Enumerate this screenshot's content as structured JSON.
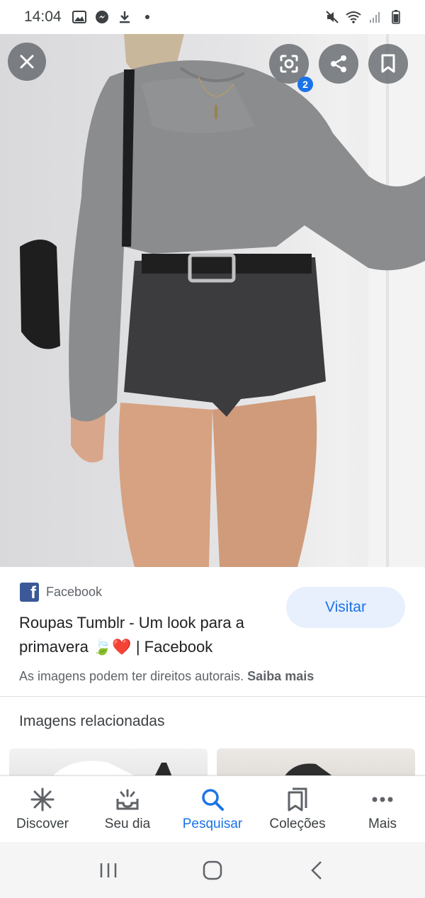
{
  "status_bar": {
    "time": "14:04",
    "left_icons": [
      "image-icon",
      "messenger-icon",
      "download-icon",
      "dot-icon"
    ],
    "right_icons": [
      "mute-icon",
      "wifi-icon",
      "signal-icon",
      "battery-icon"
    ]
  },
  "viewer": {
    "close_icon": "close-icon",
    "lens_icon": "lens-icon",
    "lens_badge": "2",
    "share_icon": "share-icon",
    "bookmark_icon": "bookmark-icon"
  },
  "source": {
    "site_name": "Facebook",
    "site_logo_letter": "f",
    "title": "Roupas Tumblr - Um look para a primavera 🍃❤️ | Facebook",
    "visit_label": "Visitar",
    "copyright_text": "As imagens podem ter direitos autorais.",
    "learn_more": "Saiba mais"
  },
  "related": {
    "heading": "Imagens relacionadas"
  },
  "bottom_nav": {
    "items": [
      {
        "label": "Discover",
        "icon": "asterisk-icon",
        "active": false
      },
      {
        "label": "Seu dia",
        "icon": "inbox-sparkle-icon",
        "active": false
      },
      {
        "label": "Pesquisar",
        "icon": "search-icon",
        "active": true
      },
      {
        "label": "Coleções",
        "icon": "collections-icon",
        "active": false
      },
      {
        "label": "Mais",
        "icon": "more-dots-icon",
        "active": false
      }
    ]
  },
  "system_nav": [
    "recents-icon",
    "home-icon",
    "back-icon"
  ],
  "colors": {
    "accent": "#1a73e8",
    "visit_bg": "#e8f0fe",
    "facebook_blue": "#3b5998"
  }
}
